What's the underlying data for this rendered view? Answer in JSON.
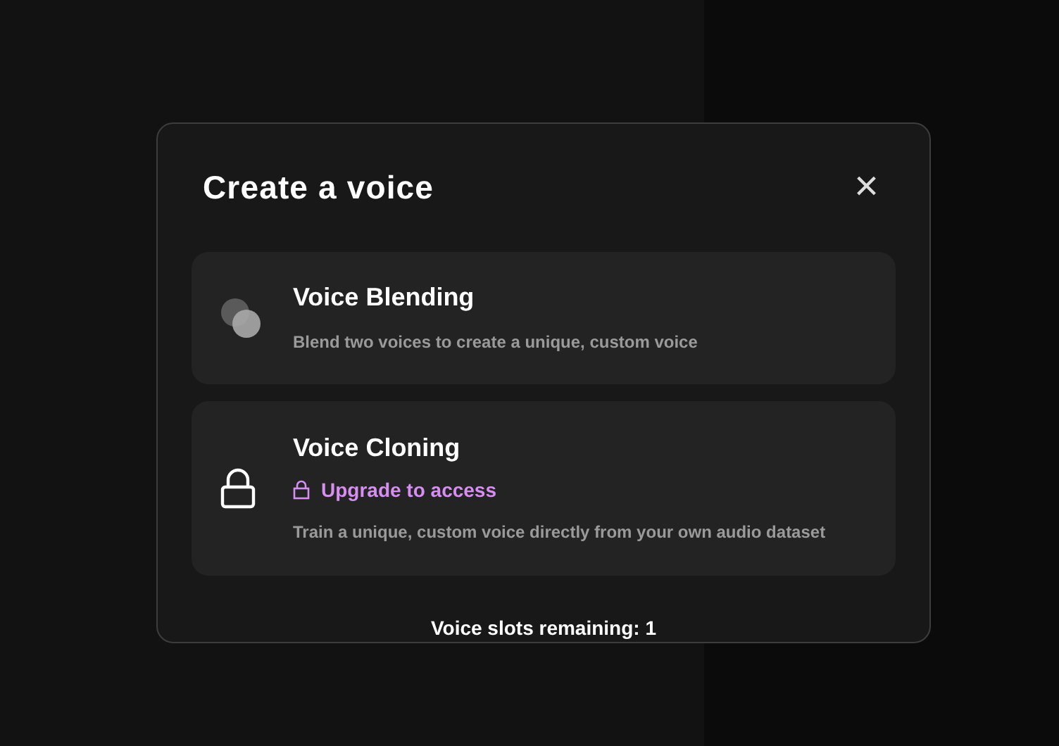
{
  "dialog": {
    "title": "Create a voice",
    "close": "×",
    "options": [
      {
        "kind": "blend",
        "title": "Voice Blending",
        "description": "Blend two voices to create a unique, custom voice",
        "locked": false
      },
      {
        "kind": "clone",
        "title": "Voice Cloning",
        "upgrade_link": "Upgrade to access",
        "description": "Train a unique, custom voice directly from your own audio dataset",
        "locked": true
      }
    ],
    "footer": "Voice slots remaining: 1"
  }
}
